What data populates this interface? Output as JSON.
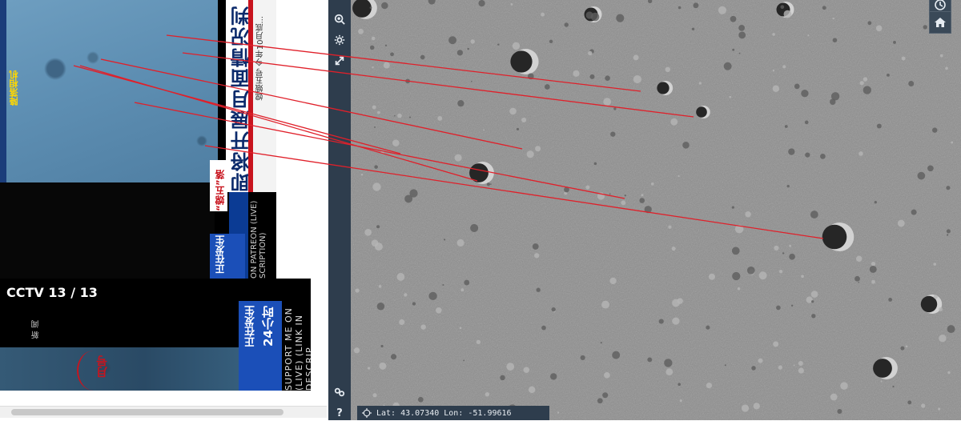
{
  "broadcast_top": {
    "camera_label": "降落相机",
    "headline": "即将开展月面情况判断 规",
    "subline": "嫦娥五号 今年10月底...",
    "tag": "“嫦五”落月",
    "badge": "正在发生",
    "live": "ON PATREON (LIVE) SCRIPTION)"
  },
  "broadcast_bottom": {
    "channel_logo": "CCTV 13 / 13",
    "channel_sub": "新 闻",
    "badge_line1": "正在发生",
    "badge_line2": "24小时",
    "support_text": "SUPPORT ME ON (LIVE) (LINK IN DESCRIP",
    "red_text": "月号"
  },
  "toolbar": {
    "items": [
      {
        "name": "zoom-search-icon"
      },
      {
        "name": "gear-icon"
      },
      {
        "name": "fullscreen-icon"
      },
      {
        "name": "link-icon"
      },
      {
        "name": "help-icon"
      }
    ],
    "help_label": "?"
  },
  "map": {
    "coords": {
      "lat_label": "Lat:",
      "lat_value": "43.07340",
      "lon_label": "Lon:",
      "lon_value": "-51.99616"
    },
    "controls": [
      "history-icon",
      "home-icon"
    ]
  },
  "colors": {
    "toolbar_bg": "#2e3d4d",
    "annotation_line": "#e0202a",
    "map_surface": "#8e8e8e"
  }
}
